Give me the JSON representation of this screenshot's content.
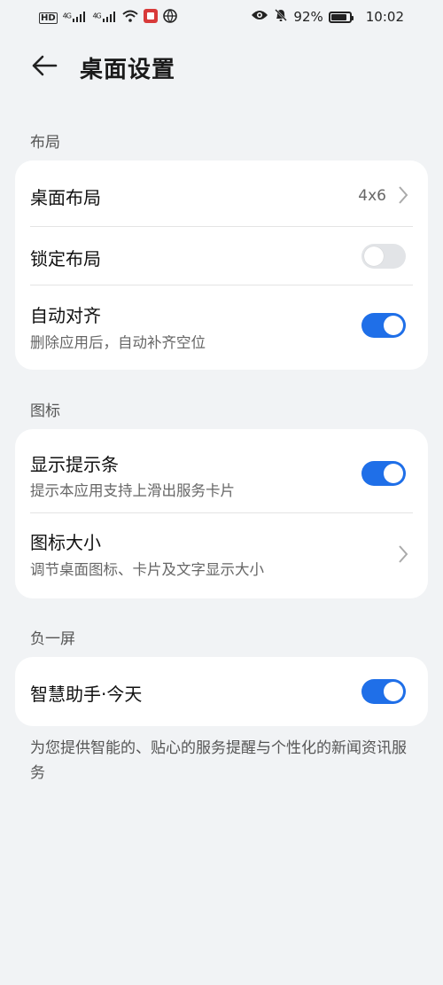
{
  "status_bar": {
    "left_badges": [
      "HD",
      "4G",
      "4G"
    ],
    "battery_percent_text": "92%",
    "battery_level": 0.92,
    "time": "10:02",
    "icons": [
      "hd-icon",
      "signal-icon",
      "signal-icon",
      "wifi-icon",
      "app-notification-icon",
      "globe-icon",
      "eye-icon",
      "mute-bell-icon",
      "battery-icon"
    ]
  },
  "header": {
    "title": "桌面设置"
  },
  "sections": {
    "layout": {
      "label": "布局",
      "desktop_layout": {
        "title": "桌面布局",
        "value": "4x6"
      },
      "lock_layout": {
        "title": "锁定布局",
        "enabled": false
      },
      "auto_align": {
        "title": "自动对齐",
        "subtitle": "删除应用后，自动补齐空位",
        "enabled": true
      }
    },
    "icons": {
      "label": "图标",
      "show_hint_bar": {
        "title": "显示提示条",
        "subtitle": "提示本应用支持上滑出服务卡片",
        "enabled": true
      },
      "icon_size": {
        "title": "图标大小",
        "subtitle": "调节桌面图标、卡片及文字显示大小"
      }
    },
    "minus_one_screen": {
      "label": "负一屏",
      "smart_assistant": {
        "title": "智慧助手·今天",
        "enabled": true
      },
      "footnote": "为您提供智能的、贴心的服务提醒与个性化的新闻资讯服务"
    }
  },
  "colors": {
    "accent": "#1f6fe8",
    "background": "#f1f3f5",
    "card": "#ffffff"
  }
}
